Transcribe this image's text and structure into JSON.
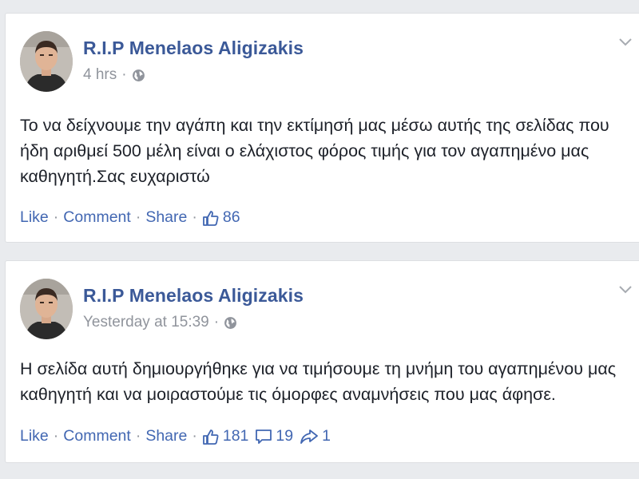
{
  "posts": [
    {
      "author": "R.I.P Menelaos Aligizakis",
      "time": "4 hrs",
      "meta_separator": "·",
      "message": "Το να δείχνουμε την αγάπη και την εκτίμησή μας μέσω αυτής της σελίδας που ήδη αριθμεί 500 μέλη είναι ο ελάχιστος φόρος τιμής για τον αγαπημένο μας καθηγητή.Σας ευχαριστώ",
      "like_label": "Like",
      "comment_label": "Comment",
      "share_label": "Share",
      "separator": "·",
      "likes": "86",
      "privacy_icon": "globe-icon",
      "menu_icon": "chevron-down-icon"
    },
    {
      "author": "R.I.P Menelaos Aligizakis",
      "time": "Yesterday at 15:39",
      "meta_separator": "·",
      "message": "Η σελίδα αυτή δημιουργήθηκε για να τιμήσουμε τη μνήμη του αγαπημένου μας καθηγητή και να μοιραστούμε τις όμορφες αναμνήσεις που μας άφησε.",
      "like_label": "Like",
      "comment_label": "Comment",
      "share_label": "Share",
      "separator": "·",
      "likes": "181",
      "comments": "19",
      "shares": "1",
      "privacy_icon": "globe-icon",
      "menu_icon": "chevron-down-icon"
    }
  ],
  "colors": {
    "author": "#3b5998",
    "link": "#4267b2",
    "muted": "#90949c",
    "text": "#1d2129",
    "background": "#e9ebee"
  }
}
